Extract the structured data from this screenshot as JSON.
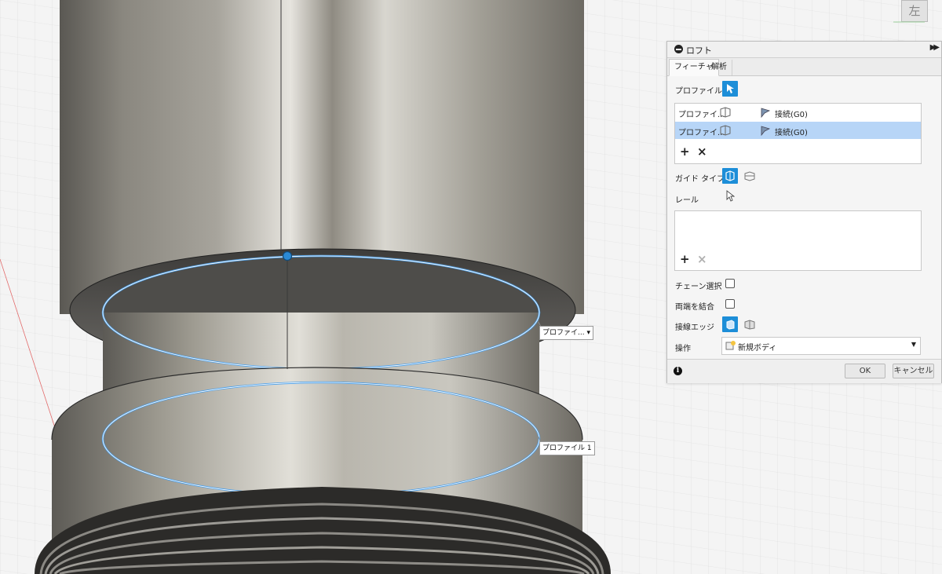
{
  "dialog": {
    "title": "ロフト",
    "tabs": [
      "フィーチャ",
      "解析"
    ],
    "profile_label": "プロファイル",
    "profiles": [
      {
        "name": "プロファイ...",
        "continuity": "接続(G0)",
        "selected": false
      },
      {
        "name": "プロファイ...",
        "continuity": "接続(G0)",
        "selected": true
      }
    ],
    "guide_type_label": "ガイド タイプ",
    "rail_label": "レール",
    "chain_select_label": "チェーン選択",
    "closed_label": "両端を結合",
    "tangent_edges_label": "接線エッジ",
    "operation_label": "操作",
    "operation_value": "新規ボディ",
    "ok": "OK",
    "cancel": "キャンセル",
    "add_symbol": "+",
    "remove_symbol": "×",
    "info_symbol": "i"
  },
  "canvas": {
    "profile_top_tag": "プロファイ... ▾",
    "profile_bottom_tag": "プロファイル 1",
    "viewcube_face": "左"
  },
  "colors": {
    "accent": "#1d8ed8",
    "selection": "#b7d5f7",
    "profile_outline": "#4a9ee8"
  }
}
